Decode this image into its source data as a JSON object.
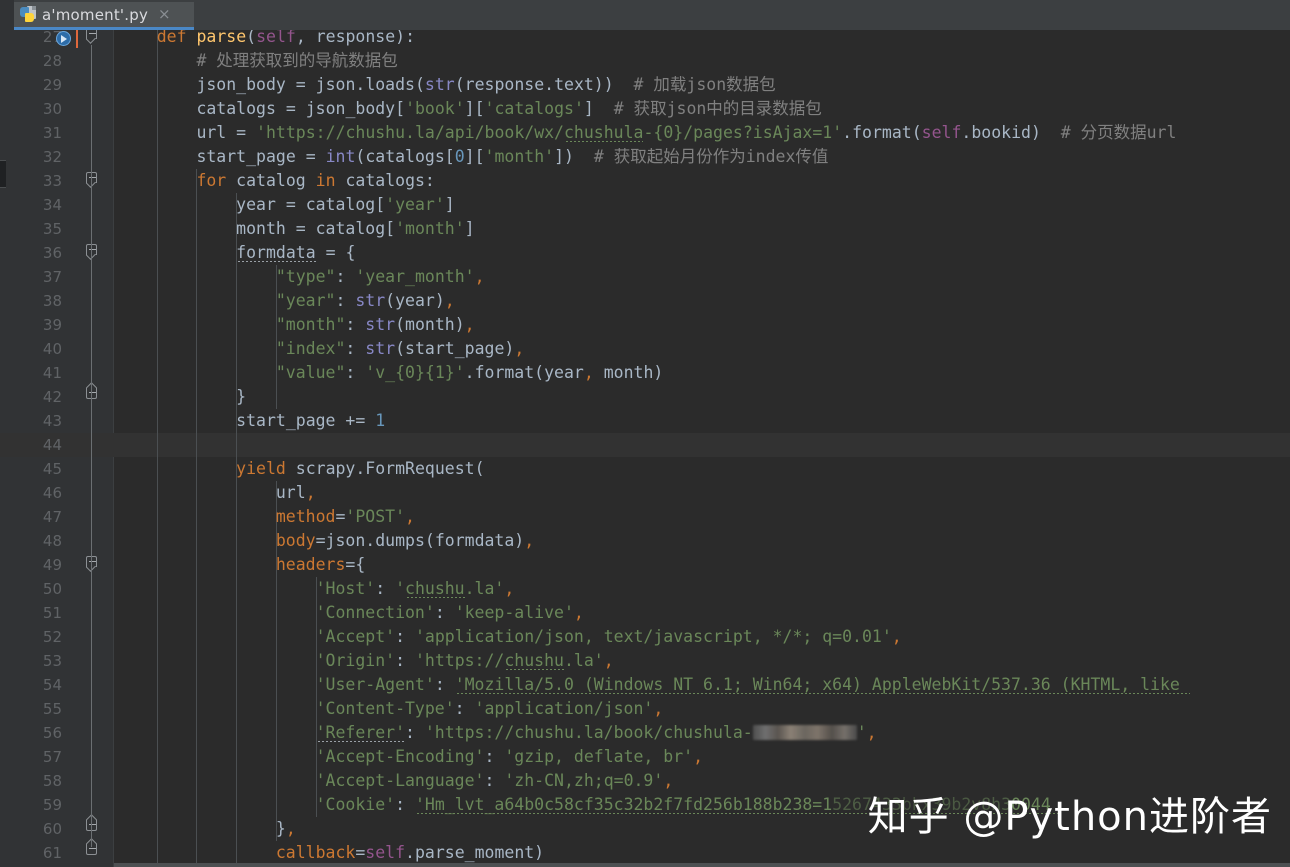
{
  "window": {
    "theme": "darcula",
    "background": "#2b2b2b",
    "gutter_background": "#313335",
    "accent": "#4a88c7"
  },
  "tabbar": {
    "tabs": [
      {
        "label": "a'moment'.py",
        "icon": "python-file-icon",
        "close_label": "×",
        "active": true
      }
    ]
  },
  "editor": {
    "language": "Python",
    "first_line": 27,
    "last_line": 61,
    "caret_line": 44,
    "run_marker_line": 27,
    "lines": [
      {
        "n": 27,
        "fold": "start"
      },
      {
        "n": 28
      },
      {
        "n": 29
      },
      {
        "n": 30
      },
      {
        "n": 31
      },
      {
        "n": 32
      },
      {
        "n": 33,
        "fold": "start"
      },
      {
        "n": 34
      },
      {
        "n": 35
      },
      {
        "n": 36,
        "fold": "start"
      },
      {
        "n": 37
      },
      {
        "n": 38
      },
      {
        "n": 39
      },
      {
        "n": 40
      },
      {
        "n": 41
      },
      {
        "n": 42,
        "fold": "end"
      },
      {
        "n": 43
      },
      {
        "n": 44
      },
      {
        "n": 45
      },
      {
        "n": 46
      },
      {
        "n": 47
      },
      {
        "n": 48
      },
      {
        "n": 49,
        "fold": "start"
      },
      {
        "n": 50
      },
      {
        "n": 51
      },
      {
        "n": 52
      },
      {
        "n": 53
      },
      {
        "n": 54
      },
      {
        "n": 55
      },
      {
        "n": 56
      },
      {
        "n": 57
      },
      {
        "n": 58
      },
      {
        "n": 59
      },
      {
        "n": 60,
        "fold": "end"
      },
      {
        "n": 61,
        "fold": "end"
      }
    ],
    "source_text": [
      "    def parse(self, response):",
      "        # 处理获取到的导航数据包",
      "        json_body = json.loads(str(response.text))  # 加载json数据包",
      "        catalogs = json_body['book']['catalogs']  # 获取json中的目录数据包",
      "        url = 'https://chushu.la/api/book/wx/chushula-{0}/pages?isAjax=1'.format(self.bookid)  # 分页数据url",
      "        start_page = int(catalogs[0]['month'])  # 获取起始月份作为index传值",
      "        for catalog in catalogs:",
      "            year = catalog['year']",
      "            month = catalog['month']",
      "            formdata = {",
      "                \"type\": 'year_month',",
      "                \"year\": str(year),",
      "                \"month\": str(month),",
      "                \"index\": str(start_page),",
      "                \"value\": 'v_{0}{1}'.format(year, month)",
      "            }",
      "            start_page += 1",
      "",
      "            yield scrapy.FormRequest(",
      "                url,",
      "                method='POST',",
      "                body=json.dumps(formdata),",
      "                headers={",
      "                    'Host': 'chushu.la',",
      "                    'Connection': 'keep-alive',",
      "                    'Accept': 'application/json, text/javascript, */*; q=0.01',",
      "                    'Origin': 'https://chushu.la',",
      "                    'User-Agent': 'Mozilla/5.0 (Windows NT 6.1; Win64; x64) AppleWebKit/537.36 (KHTML, like",
      "                    'Content-Type': 'application/json',",
      "                    'Referer': 'https://chushu.la/book/chushula-██████',",
      "                    'Accept-Encoding': 'gzip, deflate, br',",
      "                    'Accept-Language': 'zh-CN,zh;q=0.9',",
      "                    'Cookie': 'Hm_lvt_a64b0c58cf35c32b2f7fd256b188b238=1███████████0044",
      "                },",
      "                callback=self.parse_moment)"
    ]
  },
  "watermark": {
    "text": "知乎 @Python进阶者"
  }
}
